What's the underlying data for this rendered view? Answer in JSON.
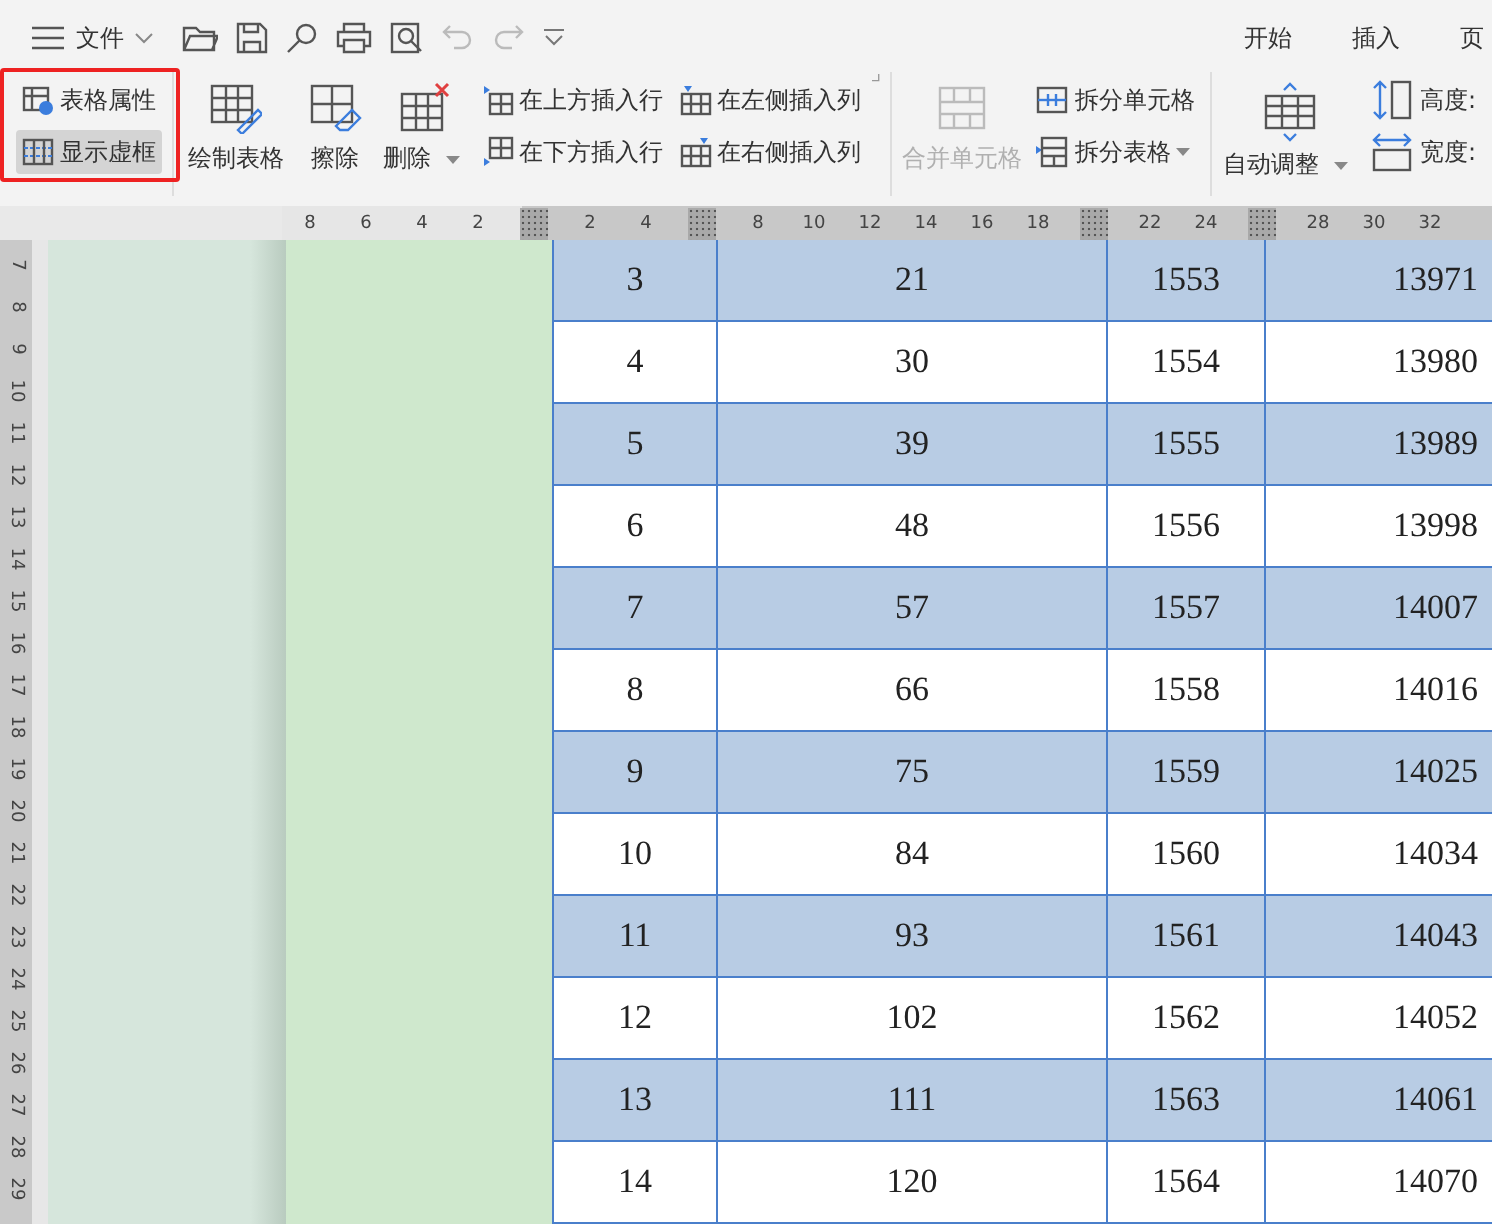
{
  "quick_bar": {
    "menu_label": "文件",
    "tabs": [
      {
        "label": "开始",
        "selected": false
      },
      {
        "label": "插入",
        "selected": false
      },
      {
        "label": "页",
        "selected": false
      }
    ]
  },
  "ribbon": {
    "groups": [
      {
        "items": [
          {
            "kind": "small",
            "label": "表格属性",
            "pressed": false,
            "disabled": false,
            "dropdown": false
          },
          {
            "kind": "small",
            "label": "显示虚框",
            "pressed": true,
            "disabled": false,
            "dropdown": false
          }
        ]
      },
      {
        "items": [
          {
            "kind": "big",
            "label": "绘制表格",
            "pressed": false,
            "disabled": false,
            "dropdown": false
          },
          {
            "kind": "big",
            "label": "擦除",
            "pressed": false,
            "disabled": false,
            "dropdown": false
          },
          {
            "kind": "big",
            "label": "删除",
            "pressed": false,
            "disabled": false,
            "dropdown": true
          },
          {
            "kind": "small",
            "label": "在上方插入行",
            "pressed": false,
            "disabled": false,
            "dropdown": false
          },
          {
            "kind": "small",
            "label": "在下方插入行",
            "pressed": false,
            "disabled": false,
            "dropdown": false
          },
          {
            "kind": "small",
            "label": "在左侧插入列",
            "pressed": false,
            "disabled": false,
            "dropdown": false
          },
          {
            "kind": "small",
            "label": "在右侧插入列",
            "pressed": false,
            "disabled": false,
            "dropdown": false
          }
        ]
      },
      {
        "items": [
          {
            "kind": "big",
            "label": "合并单元格",
            "pressed": false,
            "disabled": true,
            "dropdown": false
          },
          {
            "kind": "small",
            "label": "拆分单元格",
            "pressed": false,
            "disabled": false,
            "dropdown": false
          },
          {
            "kind": "small",
            "label": "拆分表格",
            "pressed": false,
            "disabled": false,
            "dropdown": true
          }
        ]
      },
      {
        "items": [
          {
            "kind": "big",
            "label": "自动调整",
            "pressed": false,
            "disabled": false,
            "dropdown": true
          },
          {
            "kind": "small",
            "label": "高度:",
            "pressed": false,
            "disabled": false,
            "dropdown": false
          },
          {
            "kind": "small",
            "label": "宽度:",
            "pressed": false,
            "disabled": false,
            "dropdown": false
          }
        ]
      }
    ]
  },
  "ruler": {
    "marks": [
      {
        "kind": "num",
        "label": "8"
      },
      {
        "kind": "num",
        "label": "6"
      },
      {
        "kind": "num",
        "label": "4"
      },
      {
        "kind": "num",
        "label": "2"
      },
      {
        "kind": "marker"
      },
      {
        "kind": "num",
        "label": "2"
      },
      {
        "kind": "num",
        "label": "4"
      },
      {
        "kind": "marker"
      },
      {
        "kind": "num",
        "label": "8"
      },
      {
        "kind": "num",
        "label": "10"
      },
      {
        "kind": "num",
        "label": "12"
      },
      {
        "kind": "num",
        "label": "14"
      },
      {
        "kind": "num",
        "label": "16"
      },
      {
        "kind": "num",
        "label": "18"
      },
      {
        "kind": "marker"
      },
      {
        "kind": "num",
        "label": "22"
      },
      {
        "kind": "num",
        "label": "24"
      },
      {
        "kind": "marker"
      },
      {
        "kind": "num",
        "label": "28"
      },
      {
        "kind": "num",
        "label": "30"
      },
      {
        "kind": "num",
        "label": "32"
      }
    ]
  },
  "vertical_ruler": {
    "labels": [
      "7",
      "8",
      "9",
      "10",
      "11",
      "12",
      "13",
      "14",
      "15",
      "16",
      "17",
      "18",
      "19",
      "20",
      "21",
      "22",
      "23",
      "24",
      "25",
      "26",
      "27",
      "28",
      "29"
    ]
  },
  "table": {
    "rows": [
      {
        "shaded": true,
        "cells": [
          "3",
          "21",
          "1553",
          "13971"
        ]
      },
      {
        "shaded": false,
        "cells": [
          "4",
          "30",
          "1554",
          "13980"
        ]
      },
      {
        "shaded": true,
        "cells": [
          "5",
          "39",
          "1555",
          "13989"
        ]
      },
      {
        "shaded": false,
        "cells": [
          "6",
          "48",
          "1556",
          "13998"
        ]
      },
      {
        "shaded": true,
        "cells": [
          "7",
          "57",
          "1557",
          "14007"
        ]
      },
      {
        "shaded": false,
        "cells": [
          "8",
          "66",
          "1558",
          "14016"
        ]
      },
      {
        "shaded": true,
        "cells": [
          "9",
          "75",
          "1559",
          "14025"
        ]
      },
      {
        "shaded": false,
        "cells": [
          "10",
          "84",
          "1560",
          "14034"
        ]
      },
      {
        "shaded": true,
        "cells": [
          "11",
          "93",
          "1561",
          "14043"
        ]
      },
      {
        "shaded": false,
        "cells": [
          "12",
          "102",
          "1562",
          "14052"
        ]
      },
      {
        "shaded": true,
        "cells": [
          "13",
          "111",
          "1563",
          "14061"
        ]
      },
      {
        "shaded": false,
        "cells": [
          "14",
          "120",
          "1564",
          "14070"
        ]
      }
    ]
  }
}
